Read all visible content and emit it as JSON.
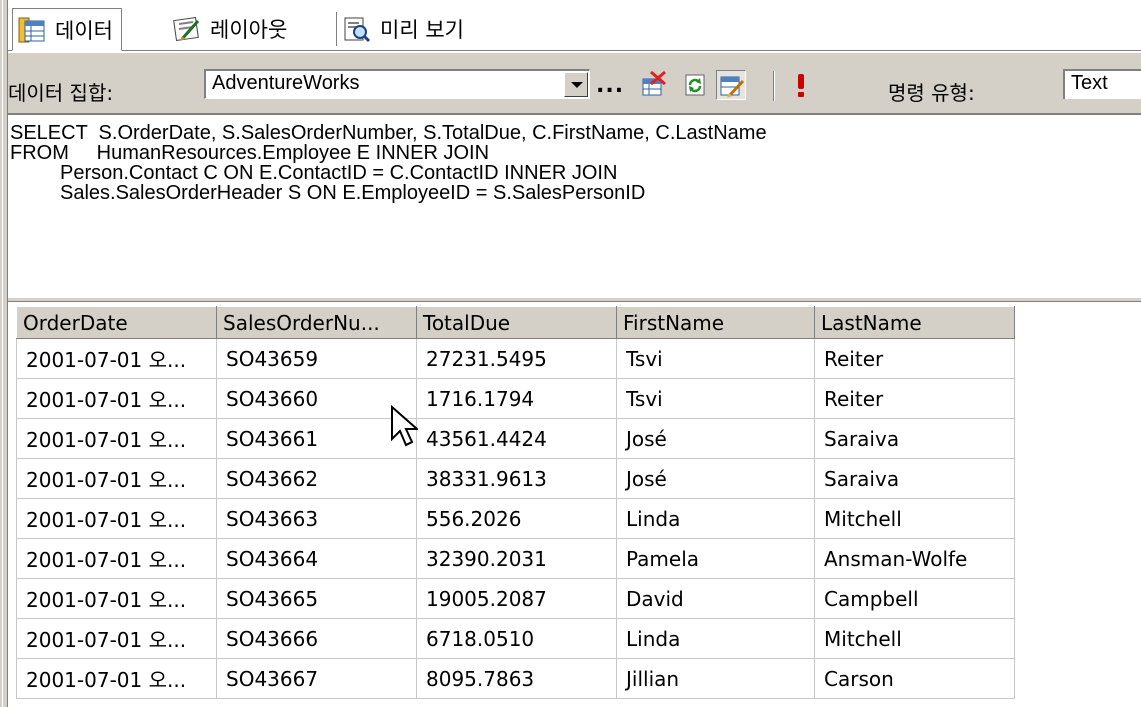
{
  "tabs": [
    {
      "label": "데이터",
      "icon": "data-sheet-icon",
      "active": true
    },
    {
      "label": "레이아웃",
      "icon": "layout-icon",
      "active": false
    },
    {
      "label": "미리 보기",
      "icon": "preview-icon",
      "active": false
    }
  ],
  "toolbar": {
    "dataset_label": "데이터 집합:",
    "dataset_value": "AdventureWorks",
    "ellipsis": "...",
    "command_type_label": "명령 유형:",
    "command_type_value": "Text",
    "buttons": [
      "delete-dataset-icon",
      "refresh-fields-icon",
      "generic-query-designer-icon",
      "run-query-icon"
    ]
  },
  "query": {
    "text": "SELECT  S.OrderDate, S.SalesOrderNumber, S.TotalDue, C.FirstName, C.LastName\nFROM     HumanResources.Employee E INNER JOIN\n         Person.Contact C ON E.ContactID = C.ContactID INNER JOIN\n         Sales.SalesOrderHeader S ON E.EmployeeID = S.SalesPersonID"
  },
  "grid": {
    "columns": [
      "OrderDate",
      "SalesOrderNu...",
      "TotalDue",
      "FirstName",
      "LastName"
    ],
    "rows": [
      [
        "2001-07-01 오...",
        "SO43659",
        "27231.5495",
        "Tsvi",
        "Reiter"
      ],
      [
        "2001-07-01 오...",
        "SO43660",
        "1716.1794",
        "Tsvi",
        "Reiter"
      ],
      [
        "2001-07-01 오...",
        "SO43661",
        "43561.4424",
        "José",
        "Saraiva"
      ],
      [
        "2001-07-01 오...",
        "SO43662",
        "38331.9613",
        "José",
        "Saraiva"
      ],
      [
        "2001-07-01 오...",
        "SO43663",
        "556.2026",
        "Linda",
        "Mitchell"
      ],
      [
        "2001-07-01 오...",
        "SO43664",
        "32390.2031",
        "Pamela",
        "Ansman-Wolfe"
      ],
      [
        "2001-07-01 오...",
        "SO43665",
        "19005.2087",
        "David",
        "Campbell"
      ],
      [
        "2001-07-01 오...",
        "SO43666",
        "6718.0510",
        "Linda",
        "Mitchell"
      ],
      [
        "2001-07-01 오...",
        "SO43667",
        "8095.7863",
        "Jillian",
        "Carson"
      ]
    ]
  },
  "colors": {
    "chrome": "#d4d0c8",
    "shadow": "#808080",
    "run_accent": "#cc0000"
  }
}
